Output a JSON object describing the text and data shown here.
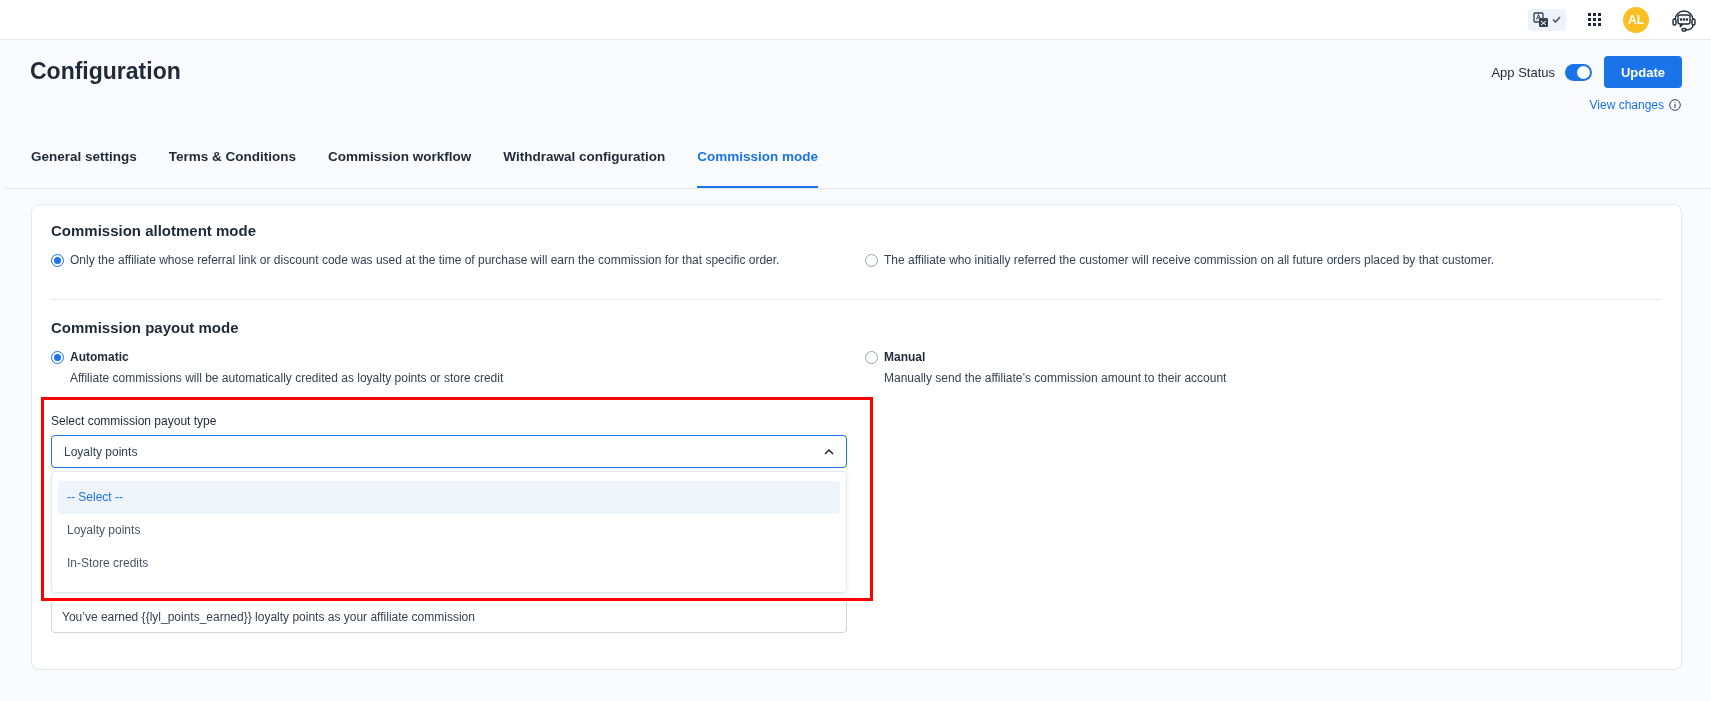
{
  "topbar": {
    "avatar": "AL"
  },
  "header": {
    "title": "Configuration",
    "app_status": {
      "label": "App Status",
      "on": true
    },
    "update_button": "Update",
    "view_changes": "View changes"
  },
  "tabs": [
    {
      "label": "General settings",
      "selected": false
    },
    {
      "label": "Terms & Conditions",
      "selected": false
    },
    {
      "label": "Commission workflow",
      "selected": false
    },
    {
      "label": "Withdrawal configuration",
      "selected": false
    },
    {
      "label": "Commission mode",
      "selected": true
    }
  ],
  "allotment": {
    "heading": "Commission allotment mode",
    "options": [
      {
        "label": "Only the affiliate whose referral link or discount code was used at the time of purchase will earn the commission for that specific order.",
        "selected": true
      },
      {
        "label": "The affiliate who initially referred the customer will receive commission on all future orders placed by that customer.",
        "selected": false
      }
    ]
  },
  "payout": {
    "heading": "Commission payout mode",
    "options": [
      {
        "label": "Automatic",
        "description": "Affiliate commissions will be automatically credited as loyalty points or store credit",
        "selected": true
      },
      {
        "label": "Manual",
        "description": "Manually send the affiliate’s commission amount to their account",
        "selected": false
      }
    ]
  },
  "payout_type": {
    "label": "Select commission payout type",
    "value": "Loyalty points",
    "expanded": true,
    "options": [
      {
        "label": "-- Select --",
        "highlighted": true
      },
      {
        "label": "Loyalty points",
        "highlighted": false
      },
      {
        "label": "In-Store credits",
        "highlighted": false
      }
    ]
  },
  "message": {
    "value": "You’ve earned {{lyl_points_earned}} loyalty points as your affiliate commission"
  }
}
